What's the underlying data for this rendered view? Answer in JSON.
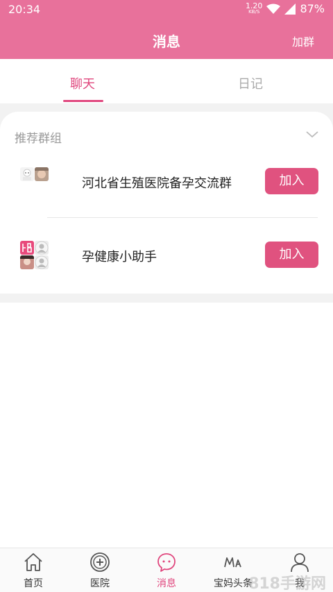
{
  "status_bar": {
    "time": "20:34",
    "net_speed_value": "1.20",
    "net_speed_unit": "KB/S",
    "battery": "87%"
  },
  "header": {
    "title": "消息",
    "join_group_label": "加群"
  },
  "tabs": [
    {
      "label": "聊天",
      "active": true
    },
    {
      "label": "日记",
      "active": false
    }
  ],
  "recommend": {
    "section_title": "推荐群组",
    "groups": [
      {
        "name": "河北省生殖医院备孕交流群",
        "join_label": "加入"
      },
      {
        "name": "孕健康小助手",
        "join_label": "加入"
      }
    ]
  },
  "bottom_nav": [
    {
      "label": "首页",
      "icon": "home-icon"
    },
    {
      "label": "医院",
      "icon": "hospital-icon"
    },
    {
      "label": "消息",
      "icon": "message-icon",
      "active": true
    },
    {
      "label": "宝妈头条",
      "icon": "headline-icon"
    },
    {
      "label": "我",
      "icon": "profile-icon"
    }
  ],
  "watermark": "818手游网",
  "colors": {
    "accent": "#e8719b",
    "active": "#e0467d",
    "button": "#e0527f"
  }
}
